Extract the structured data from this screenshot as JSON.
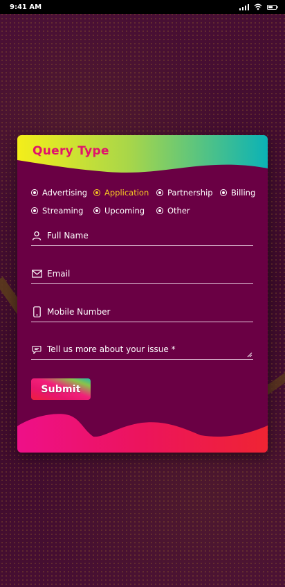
{
  "status_bar": {
    "time": "9:41 AM"
  },
  "form": {
    "title": "Query Type",
    "options_row1": [
      {
        "label": "Advertising",
        "selected": false
      },
      {
        "label": "Application",
        "selected": true
      },
      {
        "label": "Partnership",
        "selected": false
      },
      {
        "label": "Billing",
        "selected": false
      }
    ],
    "options_row2": [
      {
        "label": "Streaming",
        "selected": false
      },
      {
        "label": "Upcoming",
        "selected": false
      },
      {
        "label": "Other",
        "selected": false
      }
    ],
    "fields": {
      "full_name_placeholder": "Full Name",
      "email_placeholder": "Email",
      "mobile_placeholder": "Mobile Number",
      "issue_placeholder": "Tell us more about your issue *"
    },
    "submit_label": "Submit"
  },
  "colors": {
    "card_bg": "#6a0044",
    "title": "#e0136b",
    "selected_option": "#f6c623"
  }
}
